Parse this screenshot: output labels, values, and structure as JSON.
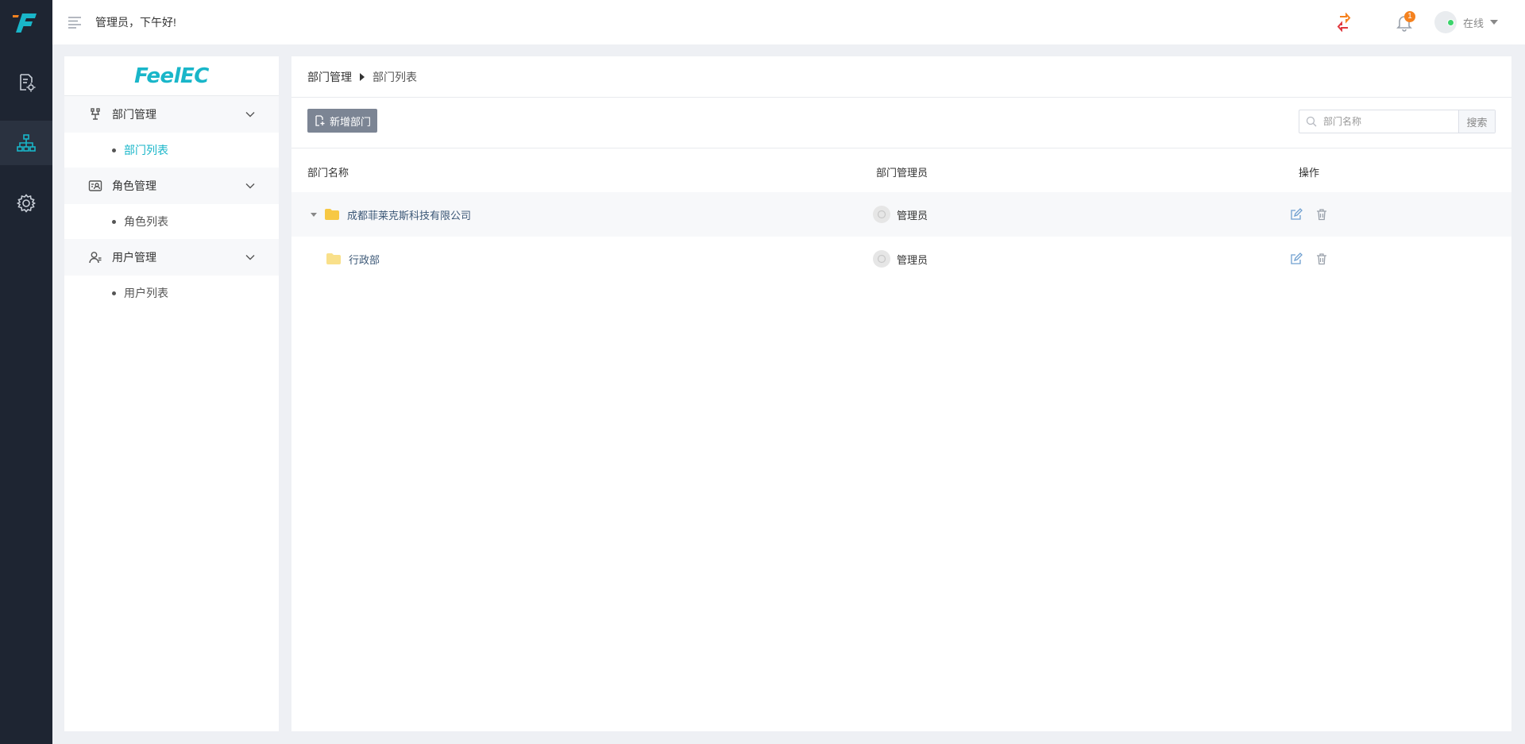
{
  "header": {
    "greeting": "管理员，下午好!",
    "notification_count": "1",
    "status": "在线"
  },
  "brand": {
    "logo_text": "FeelEC"
  },
  "sidebar": {
    "groups": [
      {
        "label": "部门管理",
        "icon": "org-icon",
        "items": [
          {
            "label": "部门列表",
            "active": true
          }
        ]
      },
      {
        "label": "角色管理",
        "icon": "role-card-icon",
        "items": [
          {
            "label": "角色列表",
            "active": false
          }
        ]
      },
      {
        "label": "用户管理",
        "icon": "user-icon",
        "items": [
          {
            "label": "用户列表",
            "active": false
          }
        ]
      }
    ]
  },
  "breadcrumb": [
    "部门管理",
    "部门列表"
  ],
  "toolbar": {
    "add_label": "新增部门",
    "search_placeholder": "部门名称",
    "search_button": "搜索"
  },
  "table": {
    "columns": [
      "部门名称",
      "部门管理员",
      "操作"
    ],
    "rows": [
      {
        "name": "成都菲莱克斯科技有限公司",
        "admin": "管理员",
        "expandable": true,
        "level": 0
      },
      {
        "name": "行政部",
        "admin": "管理员",
        "expandable": false,
        "level": 1
      }
    ]
  },
  "colors": {
    "accent": "#19b6c9",
    "rail_bg": "#1e2532",
    "badge": "#f5821f",
    "online": "#3bd36b",
    "folder": "#f7c844"
  }
}
